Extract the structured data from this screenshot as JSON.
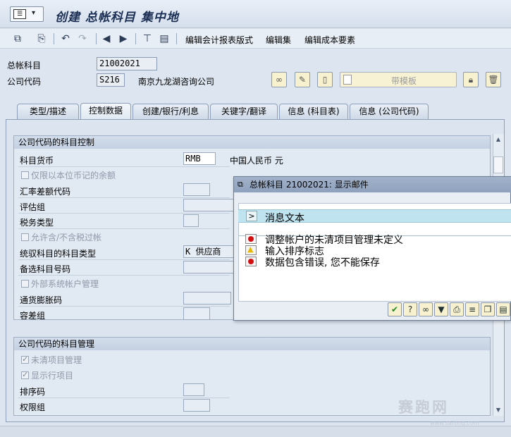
{
  "window": {
    "title": "创建 总帐科目 集中地",
    "menu_icon": "sap-menu-icon"
  },
  "toolbar": {
    "icons": [
      "display-change-icon",
      "other-object-icon",
      "undo-icon",
      "redo-icon",
      "previous-icon",
      "next-icon",
      "settings-icon",
      "doc-icon"
    ],
    "links": [
      "编辑会计报表版式",
      "编辑集",
      "编辑成本要素"
    ]
  },
  "header": {
    "gl_account_label": "总帐科目",
    "gl_account_value": "21002021",
    "company_code_label": "公司代码",
    "company_code_value": "S216",
    "company_name": "南京九龙湖咨询公司",
    "template_button": "带模板"
  },
  "tabs": [
    {
      "label": "类型/描述"
    },
    {
      "label": "控制数据",
      "active": true
    },
    {
      "label": "创建/银行/利息"
    },
    {
      "label": "关键字/翻译"
    },
    {
      "label": "信息 (科目表)"
    },
    {
      "label": "信息 (公司代码)"
    }
  ],
  "control_group": {
    "title": "公司代码的科目控制",
    "currency_label": "科目货币",
    "currency_value": "RMB",
    "currency_name": "中国人民币 元",
    "local_currency_only": "仅限以本位币记的余额",
    "fx_diff_key": "汇率差额代码",
    "valuation_group": "评估组",
    "tax_category": "税务类型",
    "post_without_tax": "允许含/不含税过帐",
    "recon_account": "统驭科目的科目类型",
    "recon_value": "K 供应商",
    "alt_account": "备选科目号码",
    "ext_mgmt": "外部系统帐户管理",
    "inflation_key": "通货膨胀码",
    "tolerance_group": "容差组"
  },
  "mgmt_group": {
    "title": "公司代码的科目管理",
    "open_item": "未清项目管理",
    "line_items": "显示行项目",
    "sort_key": "排序码",
    "auth_group": "权限组"
  },
  "dialog": {
    "title": "总帐科目 21002021: 显示邮件",
    "header": "消息文本",
    "messages": [
      {
        "type": "error",
        "text": "调整帐户的未清项目管理未定义"
      },
      {
        "type": "warning",
        "text": "输入排序标志"
      },
      {
        "type": "error",
        "text": "数据包含错误, 您不能保存"
      }
    ],
    "buttons": [
      "confirm-icon",
      "help-icon",
      "technical-info-icon",
      "filter-icon",
      "print-icon",
      "sort-icon",
      "copy-icon",
      "export-icon"
    ]
  },
  "watermark": {
    "text": "赛跑网",
    "url": "www.sailong.com"
  },
  "colors": {
    "title": "#1b2f55",
    "error": "#d20f0f",
    "warning": "#e6b800",
    "dialog_header": "#bfe3ef"
  }
}
